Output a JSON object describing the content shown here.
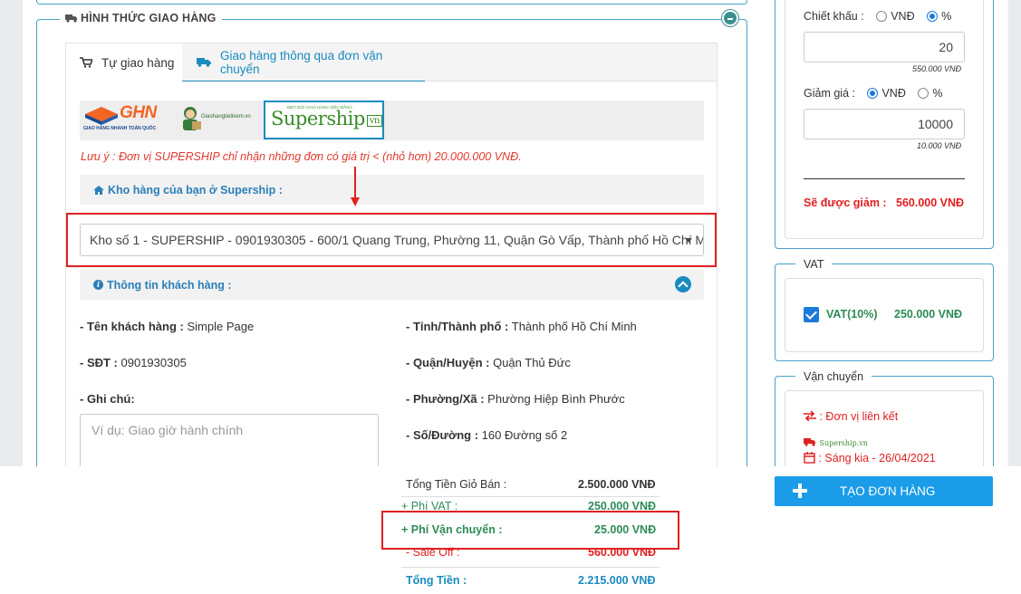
{
  "shipping_section": {
    "title": "HÌNH THỨC GIAO HÀNG",
    "tabs": [
      {
        "label": "Tự giao hàng"
      },
      {
        "label": "Giao hàng thông qua đơn vận chuyển"
      }
    ],
    "carriers": [
      {
        "name": "GHN",
        "tagline": "GIAO HÀNG NHANH TOÀN QUỐC"
      },
      {
        "name": "Giaohangtietkiem.vn"
      },
      {
        "name": "Supership",
        "suffix": "vn",
        "tagline": "BIỆT ĐỘI GIAO HÀNG SIÊU ĐẲNG"
      }
    ],
    "note": "Lưu ý : Đơn vị SUPERSHIP chỉ nhận những đơn có giá trị < (nhỏ hơn) 20.000.000 VNĐ.",
    "warehouse_header": "Kho hàng của bạn ở Supership :",
    "warehouse_selected": "Kho số 1 - SUPERSHIP - 0901930305 - 600/1 Quang Trung, Phường 11, Quận Gò Vấp, Thành phố Hồ Chí Minh",
    "customer_header": "Thông tin khách hàng :",
    "customer": {
      "name_label": "- Tên khách hàng :",
      "name_value": "Simple Page",
      "phone_label": "- SĐT :",
      "phone_value": "0901930305",
      "note_label": "- Ghi chú:",
      "note_placeholder": "Ví dụ: Giao giờ hành chính",
      "province_label": "- Tỉnh/Thành phố :",
      "province_value": "Thành phố Hồ Chí Minh",
      "district_label": "- Quận/Huyện :",
      "district_value": "Quận Thủ Đức",
      "ward_label": "- Phường/Xã :",
      "ward_value": "Phường Hiệp Bình Phước",
      "street_label": "- Số/Đường :",
      "street_value": "160 Đường số 2"
    }
  },
  "discount": {
    "discount_label": "Chiết khấu :",
    "unit_vnd": "VNĐ",
    "unit_percent": "%",
    "discount_unit_selected": "%",
    "discount_value": "20",
    "discount_hint": "550.000 VNĐ",
    "reduce_label": "Giảm giá :",
    "reduce_unit_selected": "VNĐ",
    "reduce_value": "10000",
    "reduce_hint": "10.000 VNĐ",
    "total_reduce_label": "Sẽ được giảm :",
    "total_reduce_value": "560.000 VNĐ"
  },
  "vat": {
    "title": "VAT",
    "label": "VAT(10%)",
    "amount": "250.000 VNĐ",
    "checked": true
  },
  "shipping_panel": {
    "title": "Vận chuyển",
    "partner": ": Đơn vị liên kết",
    "carrier": "Supership.vn",
    "date": ": Sáng kia - 26/04/2021"
  },
  "summary": {
    "cart_total_label": "Tổng Tiền Giỏ Bán :",
    "cart_total_value": "2.500.000 VNĐ",
    "vat_label": "+ Phí VAT :",
    "vat_value": "250.000 VNĐ",
    "ship_label": "+ Phí Vận chuyển :",
    "ship_value": "25.000 VNĐ",
    "sale_label": "- Sale Off :",
    "sale_value": "560.000 VNĐ",
    "grand_label": "Tổng Tiền :",
    "grand_value": "2.215.000 VNĐ"
  },
  "create_button": "TẠO ĐƠN HÀNG",
  "colors": {
    "accent": "#1a8bbf",
    "red": "#e02020",
    "green": "#2e8b57",
    "button": "#1a9ce8"
  }
}
